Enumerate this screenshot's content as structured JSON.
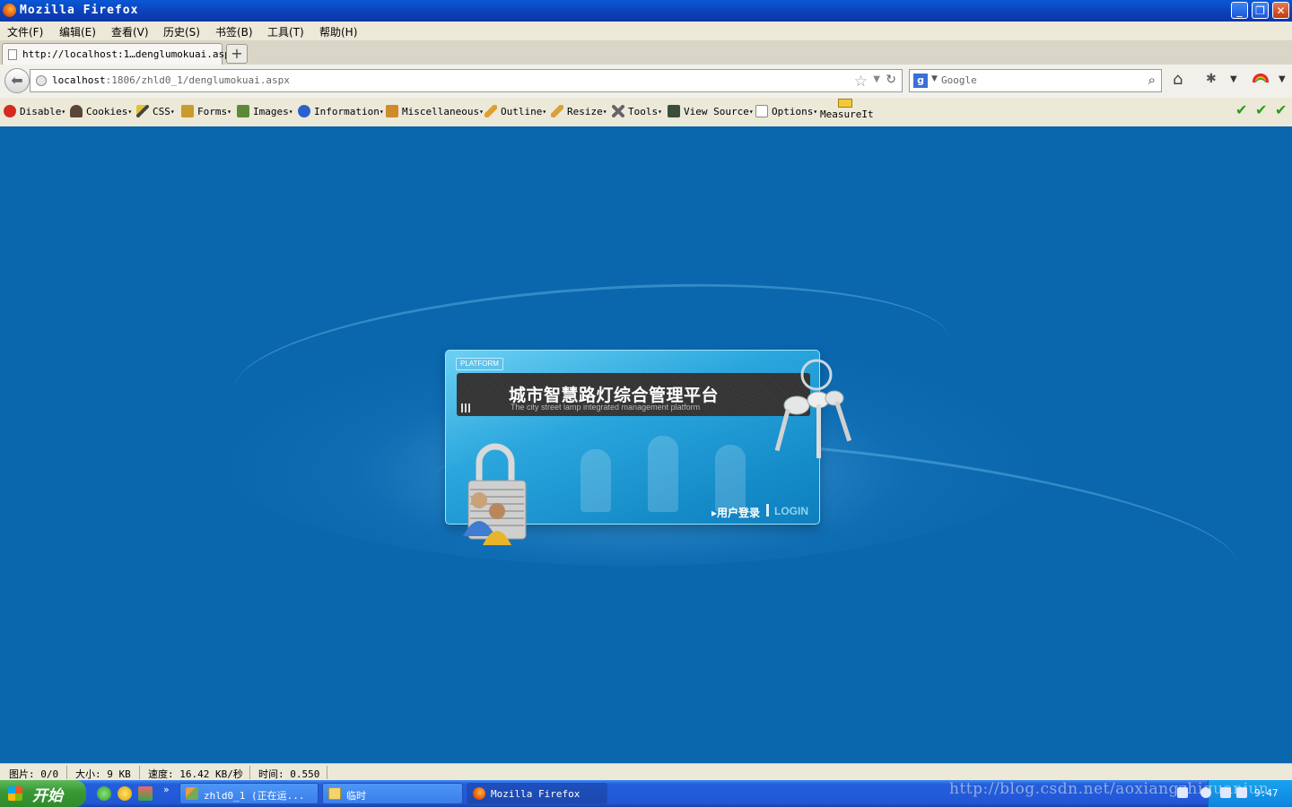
{
  "window": {
    "title": "Mozilla Firefox"
  },
  "menu": [
    "文件(F)",
    "编辑(E)",
    "查看(V)",
    "历史(S)",
    "书签(B)",
    "工具(T)",
    "帮助(H)"
  ],
  "tab": {
    "label": "http://localhost:1…denglumokuai.aspx",
    "new_tab_label": "+"
  },
  "nav": {
    "url_host": "localhost",
    "url_rest": ":1806/zhld0_1/denglumokuai.aspx",
    "search_placeholder": "Google",
    "search_engine_glyph": "g"
  },
  "devbar": {
    "items": [
      {
        "label": "Disable",
        "icon": "disable-icon",
        "color": "#d42b1e"
      },
      {
        "label": "Cookies",
        "icon": "cookies-icon",
        "color": "#5a4636"
      },
      {
        "label": "CSS",
        "icon": "css-icon",
        "color": "#e3c232"
      },
      {
        "label": "Forms",
        "icon": "forms-icon",
        "color": "#c99a2e"
      },
      {
        "label": "Images",
        "icon": "images-icon",
        "color": "#5d8a3a"
      },
      {
        "label": "Information",
        "icon": "information-icon",
        "color": "#2a62c9"
      },
      {
        "label": "Miscellaneous",
        "icon": "miscellaneous-icon",
        "color": "#cf8a2a"
      },
      {
        "label": "Outline",
        "icon": "outline-icon",
        "color": "#e0a030"
      },
      {
        "label": "Resize",
        "icon": "resize-icon",
        "color": "#d7a23a"
      },
      {
        "label": "Tools",
        "icon": "tools-icon",
        "color": "#666666"
      },
      {
        "label": "View Source",
        "icon": "view-source-icon",
        "color": "#3b4d3b"
      },
      {
        "label": "Options",
        "icon": "options-icon",
        "color": "#8a8a8a"
      }
    ],
    "measure_label": "MeasureIt"
  },
  "login_card": {
    "tag": "PLATFORM",
    "title": "城市智慧路灯综合管理平台",
    "subtitle": "The city street lamp integrated management platform",
    "login_cn": "▸用户登录",
    "login_en": "LOGIN"
  },
  "status": {
    "images": "图片: 0/0",
    "size": "大小: 9 KB",
    "speed": "速度: 16.42 KB/秒",
    "time": "时间: 0.550"
  },
  "taskbar": {
    "start_label": "开始",
    "quicklaunch_more": "»",
    "tasks": [
      {
        "label": "zhld0_1 (正在运...",
        "icon": "visual-studio-icon"
      },
      {
        "label": "临时",
        "icon": "folder-icon"
      },
      {
        "label": "Mozilla Firefox",
        "icon": "firefox-icon"
      }
    ],
    "clock": "9:47",
    "watermark": "http://blog.csdn.net/aoxiangzhiguanjun"
  },
  "colors": {
    "desktop_blue": "#0a66ad",
    "xp_blue": "#245edb",
    "start_green": "#3a9a36"
  }
}
